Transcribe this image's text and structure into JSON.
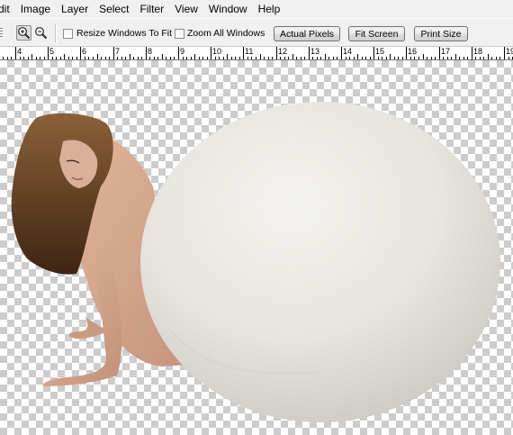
{
  "menu": [
    "dit",
    "Image",
    "Layer",
    "Select",
    "Filter",
    "View",
    "Window",
    "Help"
  ],
  "options": {
    "resize_windows_label": "Resize Windows To Fit",
    "resize_windows_checked": false,
    "zoom_all_label": "Zoom All Windows",
    "zoom_all_checked": false,
    "actual_pixels_label": "Actual Pixels",
    "fit_screen_label": "Fit Screen",
    "print_size_label": "Print Size"
  },
  "ruler": {
    "labels": [
      "4",
      "5",
      "6",
      "7",
      "8",
      "9",
      "10",
      "11",
      "12",
      "13",
      "14",
      "15",
      "16",
      "17",
      "18",
      "19"
    ]
  },
  "icons": {
    "zoom_in": "zoom-in-icon",
    "zoom_out": "zoom-out-icon"
  },
  "colors": {
    "checker_dark": "#cccccc",
    "checker_light": "#ffffff",
    "egg": "#e9e7e2",
    "skin": "#d7a98d",
    "hair": "#5b3a1e"
  }
}
